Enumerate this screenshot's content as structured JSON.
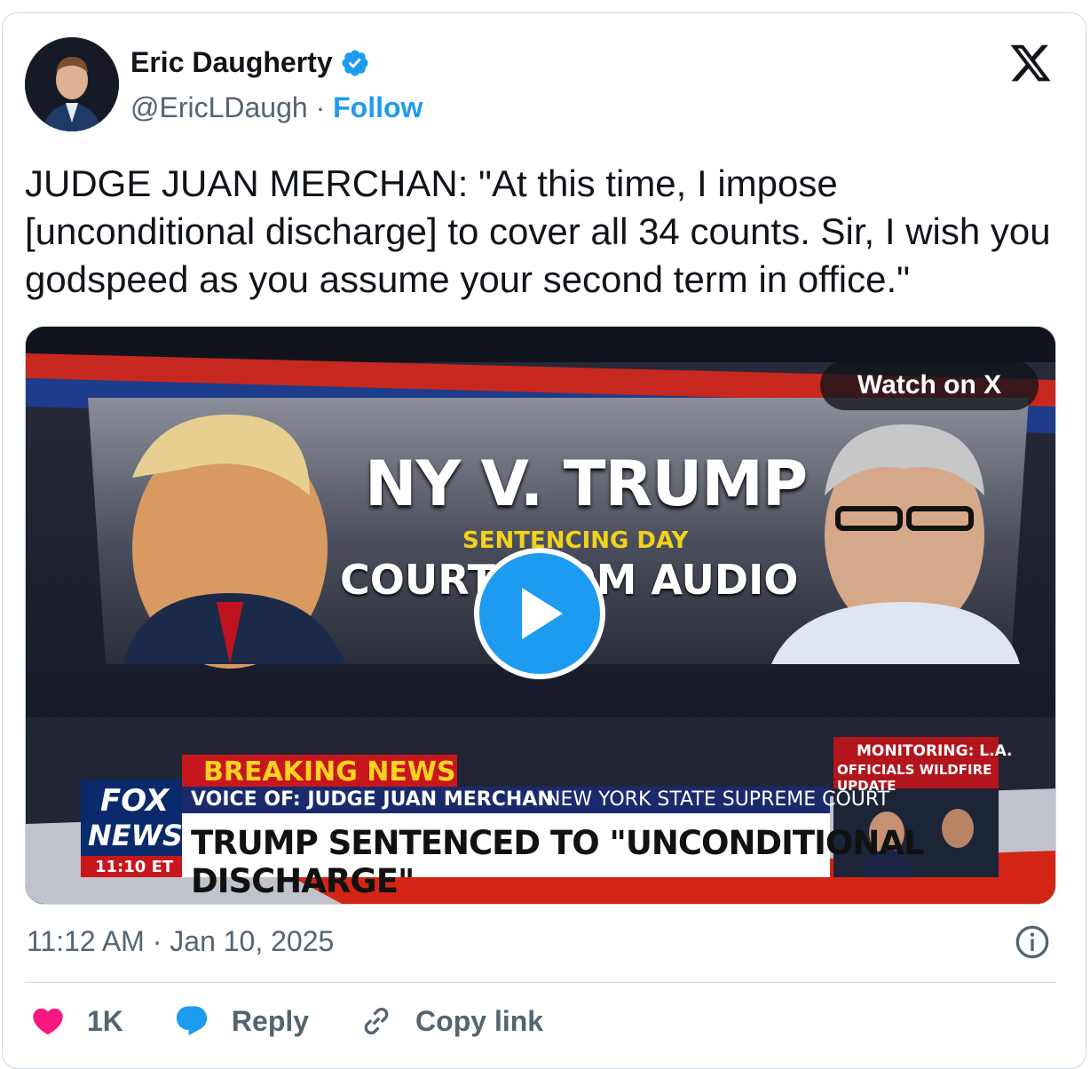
{
  "author": {
    "name": "Eric Daugherty",
    "handle": "@EricLDaugh",
    "separator": "·",
    "follow_label": "Follow"
  },
  "tweet_text": "JUDGE JUAN MERCHAN: \"At this time, I impose [unconditional discharge] to cover all 34 counts. Sir, I wish you godspeed as you assume your second term in office.\"",
  "media": {
    "watch_label": "Watch on X",
    "title": "NY V. TRUMP",
    "subtitle": "SENTENCING DAY",
    "audio_label": "COURTROOM AUDIO",
    "breaking": "BREAKING NEWS",
    "voice_of": "VOICE OF: JUDGE JUAN MERCHAN",
    "court": "NEW YORK STATE SUPREME COURT",
    "headline": "TRUMP SENTENCED TO \"UNCONDITIONAL DISCHARGE\"",
    "network_line1": "FOX",
    "network_line2": "NEWS",
    "time_bug": "11:10 ET",
    "monitoring_line1": "MONITORING: L.A.",
    "monitoring_line2": "OFFICIALS WILDFIRE UPDATE"
  },
  "timestamp": "11:12 AM · Jan 10, 2025",
  "actions": {
    "like_count": "1K",
    "reply_label": "Reply",
    "copy_label": "Copy link"
  },
  "colors": {
    "accent": "#1d9bf0",
    "like": "#f91880",
    "secondary_text": "#536471"
  },
  "icons": [
    "verified-badge-icon",
    "x-logo-icon",
    "play-icon",
    "info-icon",
    "heart-icon",
    "reply-icon",
    "link-icon"
  ]
}
